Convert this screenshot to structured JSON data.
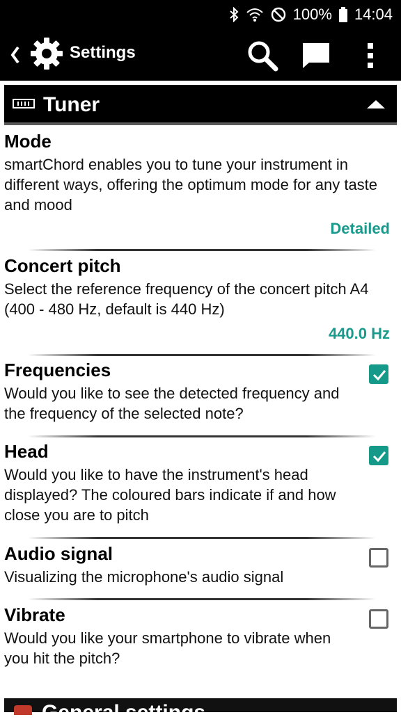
{
  "status_bar": {
    "battery_percent": "100%",
    "time": "14:04",
    "icons": [
      "bluetooth-icon",
      "wifi-icon",
      "do-not-disturb-icon",
      "battery-icon"
    ]
  },
  "app_bar": {
    "title": "Settings",
    "icons": [
      "back-chevron-icon",
      "gear-icon",
      "search-icon",
      "chat-icon",
      "more-vert-icon"
    ]
  },
  "section": {
    "title": "Tuner",
    "icon": "tuner-icon",
    "collapse_icon": "triangle-up-icon"
  },
  "settings": [
    {
      "title": "Mode",
      "description": "smartChord enables you to tune your instrument in different ways, offering the optimum mode for any taste and mood",
      "value": "Detailed"
    },
    {
      "title": "Concert pitch",
      "description": "Select the reference frequency of the concert pitch A4 (400 - 480 Hz, default is 440 Hz)",
      "value": "440.0 Hz"
    },
    {
      "title": "Frequencies",
      "description": "Would you like to see the detected frequency and the frequency of the selected note?",
      "checked": true
    },
    {
      "title": "Head",
      "description": "Would you like to have the instrument's head displayed? The coloured bars indicate if and how close you are to pitch",
      "checked": true
    },
    {
      "title": "Audio signal",
      "description": "Visualizing the microphone's audio signal",
      "checked": false
    },
    {
      "title": "Vibrate",
      "description": "Would you like your smartphone to vibrate when you hit the pitch?",
      "checked": false
    }
  ],
  "colors": {
    "accent": "#1a9a8c",
    "checkbox_on": "#159a8a",
    "bar": "#000000"
  },
  "next_section": {
    "title_partial": "General settings",
    "icon": "red-section-icon"
  }
}
